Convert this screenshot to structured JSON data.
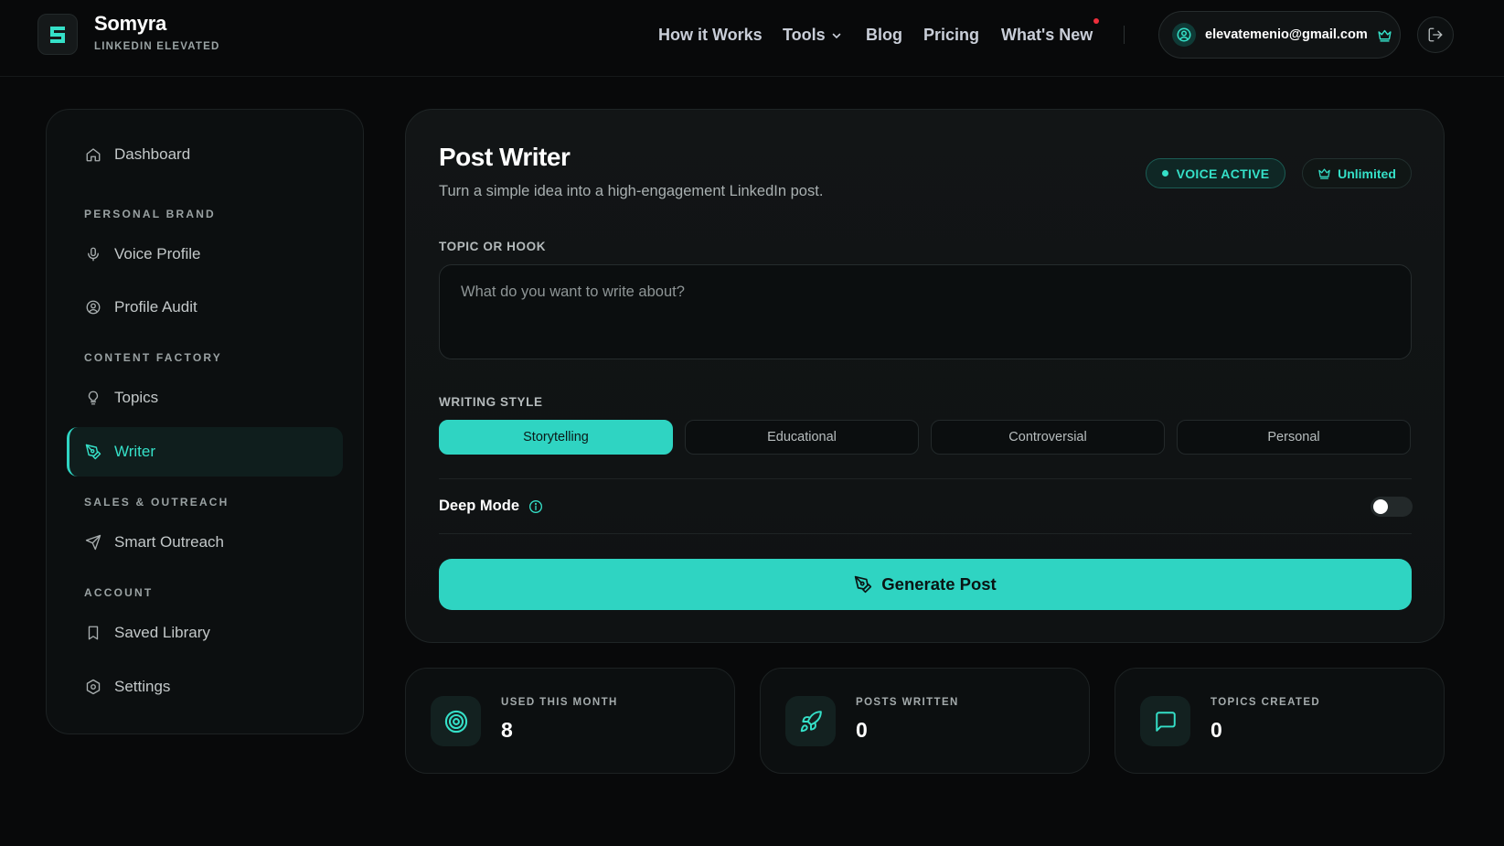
{
  "brand": {
    "name": "Somyra",
    "tagline": "LINKEDIN ELEVATED"
  },
  "nav": {
    "items": [
      {
        "label": "How it Works"
      },
      {
        "label": "Tools"
      },
      {
        "label": "Blog"
      },
      {
        "label": "Pricing"
      },
      {
        "label": "What's New"
      }
    ]
  },
  "account": {
    "email": "elevatemenio@gmail.com"
  },
  "sidebar": {
    "dashboard": "Dashboard",
    "sections": {
      "personal_brand": "PERSONAL BRAND",
      "content_factory": "CONTENT FACTORY",
      "sales_outreach": "SALES & OUTREACH",
      "account": "ACCOUNT"
    },
    "items": {
      "voice_profile": "Voice Profile",
      "profile_audit": "Profile Audit",
      "topics": "Topics",
      "writer": "Writer",
      "smart_outreach": "Smart Outreach",
      "saved_library": "Saved Library",
      "settings": "Settings"
    },
    "active": "Writer"
  },
  "writer": {
    "title": "Post Writer",
    "subtitle": "Turn a simple idea into a high-engagement LinkedIn post.",
    "voice_badge": "VOICE ACTIVE",
    "plan_badge": "Unlimited",
    "topic_label": "TOPIC OR HOOK",
    "topic_placeholder": "What do you want to write about?",
    "topic_value": "",
    "style_label": "WRITING STYLE",
    "styles": [
      "Storytelling",
      "Educational",
      "Controversial",
      "Personal"
    ],
    "selected_style": "Storytelling",
    "deep_mode_label": "Deep Mode",
    "deep_mode_on": false,
    "generate_label": "Generate Post"
  },
  "stats": [
    {
      "label": "USED THIS MONTH",
      "value": "8",
      "icon": "target-icon"
    },
    {
      "label": "POSTS WRITTEN",
      "value": "0",
      "icon": "rocket-icon"
    },
    {
      "label": "TOPICS CREATED",
      "value": "0",
      "icon": "chat-icon"
    }
  ],
  "colors": {
    "accent": "#2fd4c2",
    "background": "#08090a",
    "notification": "#ef2f3c"
  }
}
